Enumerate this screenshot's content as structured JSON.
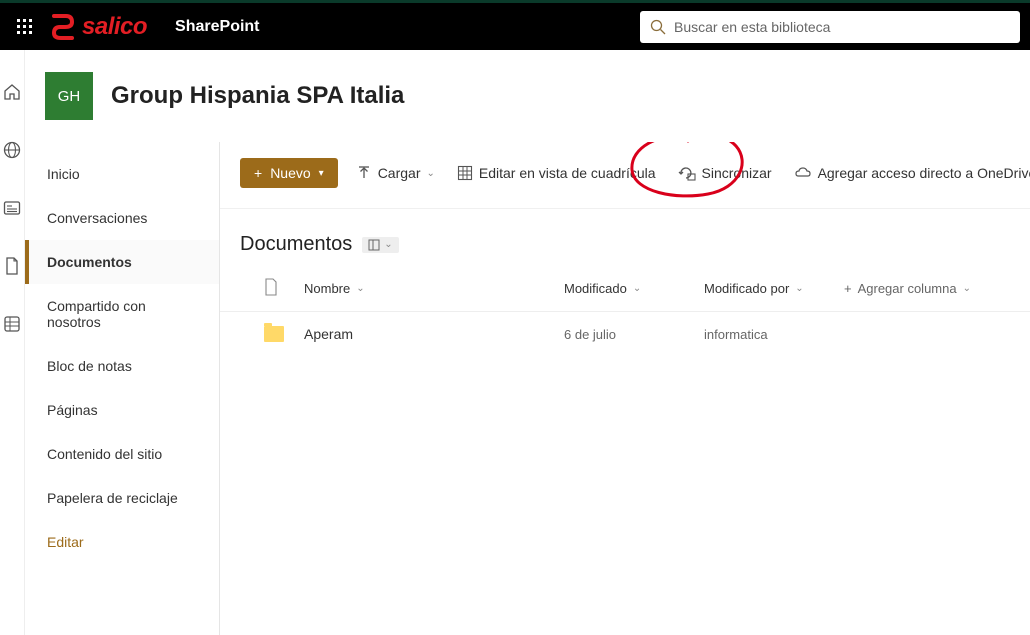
{
  "header": {
    "brand_logo_text": "salico",
    "app_name": "SharePoint",
    "search_placeholder": "Buscar en esta biblioteca"
  },
  "site": {
    "logo_initials": "GH",
    "title": "Group Hispania SPA Italia"
  },
  "sidenav": {
    "items": [
      {
        "label": "Inicio",
        "active": false
      },
      {
        "label": "Conversaciones",
        "active": false
      },
      {
        "label": "Documentos",
        "active": true
      },
      {
        "label": "Compartido con nosotros",
        "active": false
      },
      {
        "label": "Bloc de notas",
        "active": false
      },
      {
        "label": "Páginas",
        "active": false
      },
      {
        "label": "Contenido del sitio",
        "active": false
      },
      {
        "label": "Papelera de reciclaje",
        "active": false
      }
    ],
    "edit_label": "Editar"
  },
  "commands": {
    "new_label": "Nuevo",
    "upload_label": "Cargar",
    "grid_label": "Editar en vista de cuadrícula",
    "sync_label": "Sincronizar",
    "shortcut_label": "Agregar acceso directo a OneDrive"
  },
  "library": {
    "title": "Documentos",
    "columns": {
      "name": "Nombre",
      "modified": "Modificado",
      "modified_by": "Modificado por",
      "add": "Agregar columna"
    },
    "rows": [
      {
        "name": "Aperam",
        "modified": "6 de julio",
        "modified_by": "informatica"
      }
    ]
  }
}
